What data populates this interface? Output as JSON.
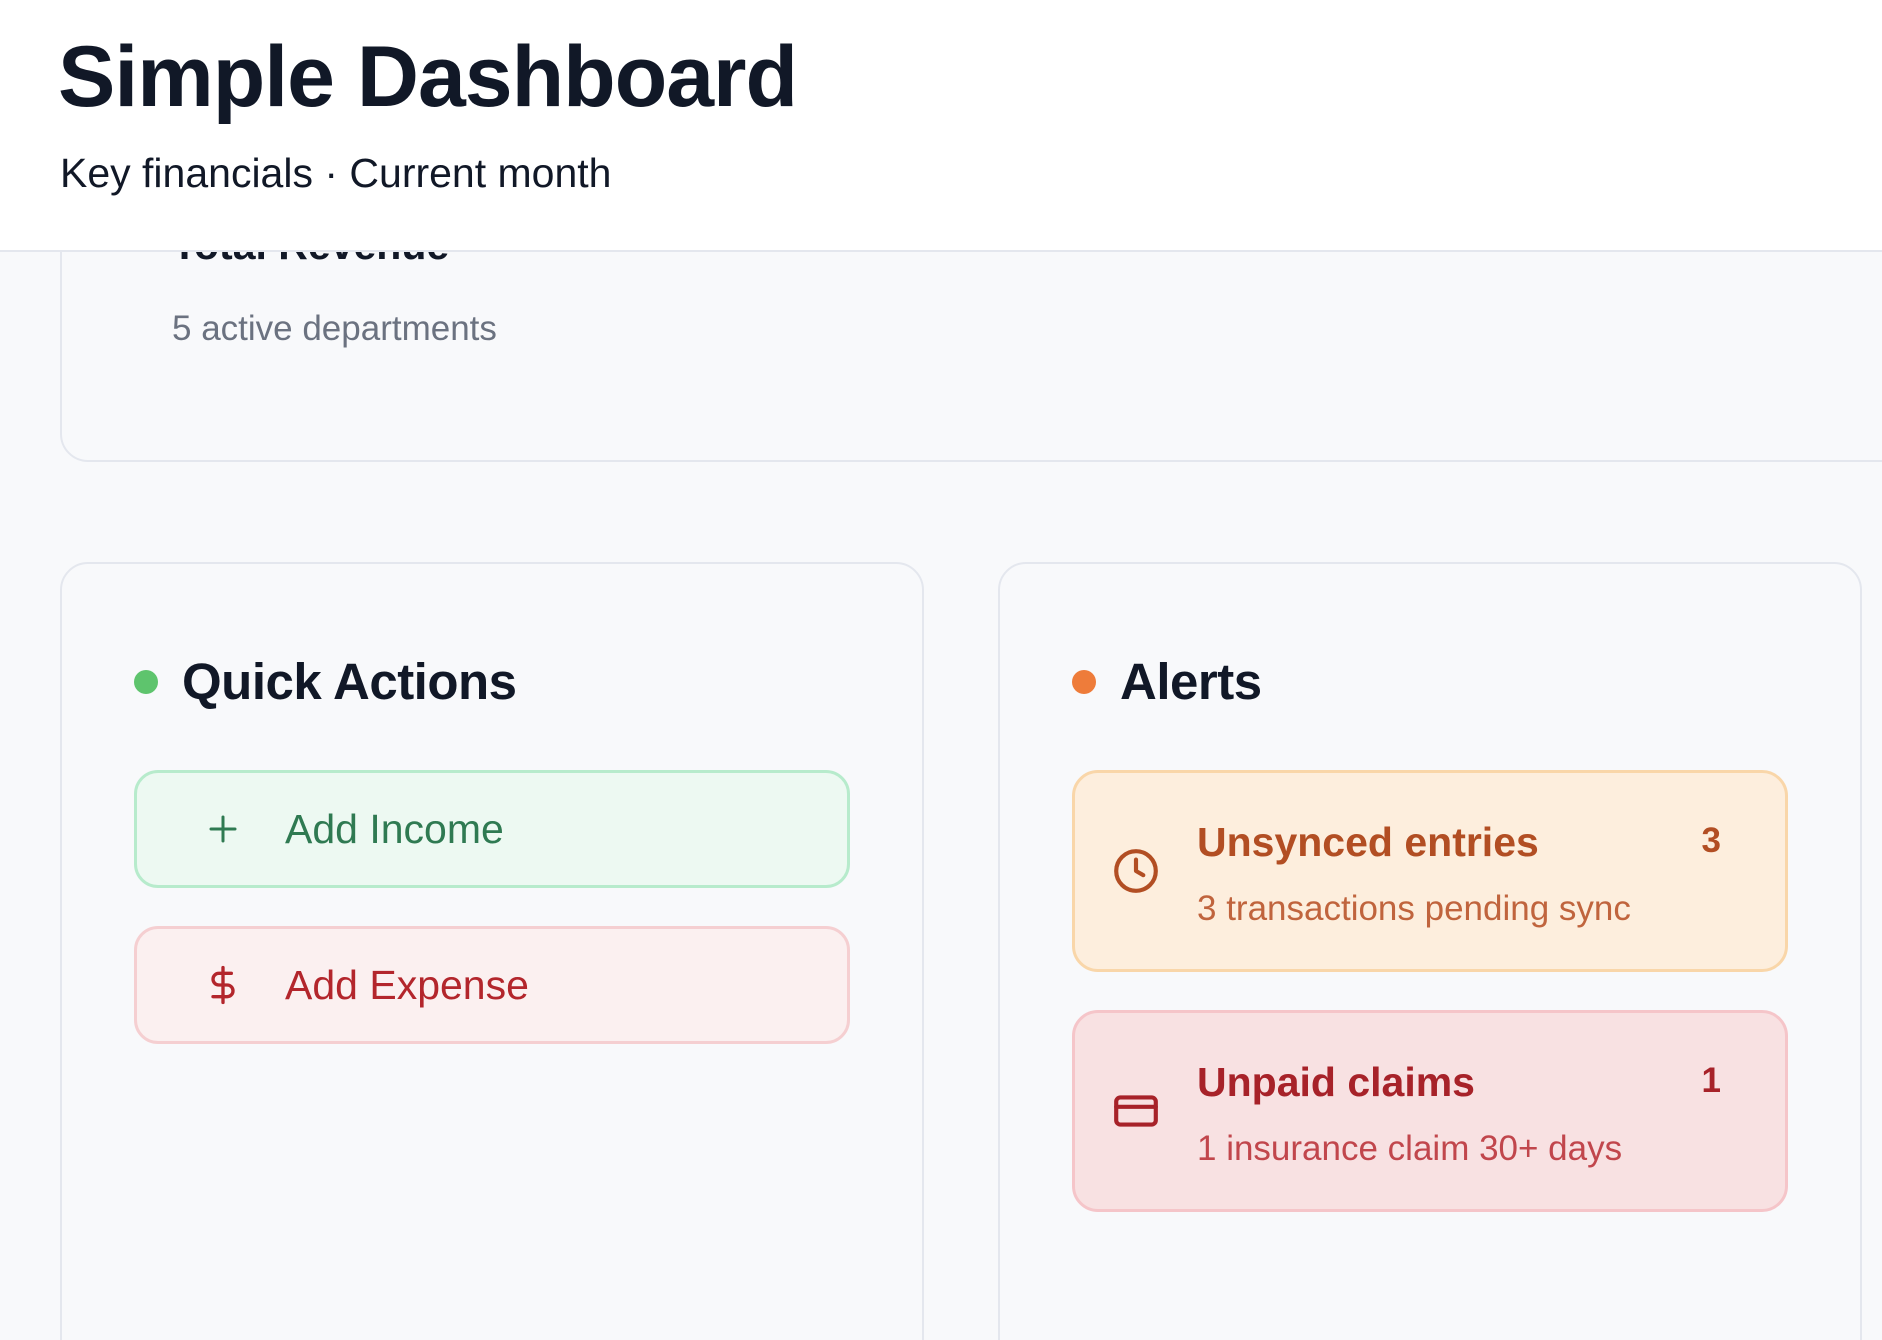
{
  "header": {
    "title": "Simple Dashboard",
    "subtitle": "Key financials · Current month"
  },
  "summary": {
    "title": "Total Revenue",
    "subtitle": "5 active departments"
  },
  "quick_actions": {
    "title": "Quick Actions",
    "indicator_color": "#5ec46d",
    "buttons": [
      {
        "label": "Add Income",
        "icon": "plus-icon",
        "color": "#2f7a52"
      },
      {
        "label": "Add Expense",
        "icon": "dollar-icon",
        "color": "#b3262c"
      }
    ]
  },
  "alerts": {
    "title": "Alerts",
    "indicator_color": "#ee7c3a",
    "items": [
      {
        "title": "Unsynced entries",
        "count": "3",
        "description": "3 transactions pending sync",
        "icon": "clock-icon",
        "color": "#b24e23"
      },
      {
        "title": "Unpaid claims",
        "count": "1",
        "description": "1 insurance claim 30+ days",
        "icon": "credit-card-icon",
        "color": "#a72229"
      }
    ]
  }
}
